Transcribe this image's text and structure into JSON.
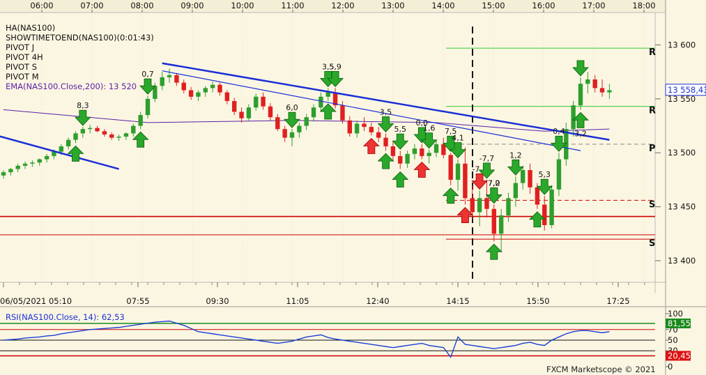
{
  "time_axis_top": [
    "06:00",
    "07:00",
    "08:00",
    "09:00",
    "10:00",
    "11:00",
    "12:00",
    "13:00",
    "14:00",
    "15:00",
    "16:00",
    "17:00",
    "18:00"
  ],
  "date_axis_bottom": [
    "06/05/2021 05:10",
    "07:55",
    "09:30",
    "11:05",
    "12:40",
    "14:15",
    "15:50",
    "17:25"
  ],
  "legend": [
    "HA(NAS100)",
    "SHOWTIMETOEND(NAS100)(0:01:43)",
    "PIVOT J",
    "PIVOT 4H",
    "PIVOT S",
    "PIVOT M"
  ],
  "ema_label": "EMA(NAS100.Close,200): 13 520",
  "rsi_label": "RSI(NAS100.Close, 14): 62,53",
  "copyright": "FXCM Marketscope © 2021",
  "colors": {
    "background": "#fbf6e2",
    "bull_candle": "#2e9e2e",
    "bear_candle": "#e02020",
    "trendline": "#1a2fd6",
    "ema": "#5a1fa8",
    "pivot_red": "#cc0000",
    "pivot_green": "#33cc33",
    "rsi_line": "#1a3fd6"
  },
  "chart_data": {
    "type": "candlestick",
    "price_axis": {
      "ticks": [
        13600,
        13550,
        13500,
        13450,
        13400
      ],
      "tick_labels": [
        "13 600",
        "13 550",
        "13 500",
        "13 450",
        "13 400"
      ],
      "range": [
        13380,
        13630
      ]
    },
    "current_price": {
      "value": 13558.43,
      "label": "13 558,43"
    },
    "pivot_lines": [
      {
        "label": "R",
        "value": 13597,
        "color": "#33cc33",
        "style": "solid"
      },
      {
        "label": "R",
        "value": 13543,
        "color": "#33cc33",
        "style": "solid"
      },
      {
        "label": "P",
        "value": 13508,
        "color": "#888888",
        "style": "dashed"
      },
      {
        "label": "S",
        "value": 13456,
        "color": "#cc0000",
        "style": "dashed"
      },
      {
        "label": "S",
        "value": 13420,
        "color": "#cc0000",
        "style": "solid"
      },
      {
        "label": "",
        "value": 13441,
        "color": "#cc0000",
        "style": "solid"
      },
      {
        "label": "",
        "value": 13424,
        "color": "#cc0000",
        "style": "solid"
      }
    ],
    "ohlc": [
      [
        13479,
        13484,
        13476,
        13482
      ],
      [
        13482,
        13486,
        13479,
        13485
      ],
      [
        13485,
        13490,
        13482,
        13488
      ],
      [
        13488,
        13492,
        13485,
        13490
      ],
      [
        13490,
        13493,
        13487,
        13491
      ],
      [
        13491,
        13495,
        13488,
        13494
      ],
      [
        13494,
        13499,
        13491,
        13497
      ],
      [
        13497,
        13503,
        13494,
        13501
      ],
      [
        13501,
        13508,
        13498,
        13506
      ],
      [
        13506,
        13514,
        13503,
        13512
      ],
      [
        13512,
        13520,
        13509,
        13518
      ],
      [
        13518,
        13524,
        13514,
        13522
      ],
      [
        13522,
        13526,
        13518,
        13523
      ],
      [
        13523,
        13525,
        13519,
        13520
      ],
      [
        13520,
        13522,
        13515,
        13517
      ],
      [
        13517,
        13519,
        13512,
        13514
      ],
      [
        13514,
        13517,
        13511,
        13515
      ],
      [
        13515,
        13519,
        13512,
        13518
      ],
      [
        13518,
        13527,
        13515,
        13525
      ],
      [
        13525,
        13538,
        13522,
        13535
      ],
      [
        13535,
        13553,
        13532,
        13550
      ],
      [
        13550,
        13565,
        13547,
        13562
      ],
      [
        13562,
        13575,
        13558,
        13570
      ],
      [
        13570,
        13578,
        13565,
        13572
      ],
      [
        13572,
        13574,
        13562,
        13565
      ],
      [
        13565,
        13568,
        13555,
        13558
      ],
      [
        13558,
        13561,
        13549,
        13552
      ],
      [
        13552,
        13558,
        13548,
        13556
      ],
      [
        13556,
        13562,
        13552,
        13560
      ],
      [
        13560,
        13566,
        13556,
        13563
      ],
      [
        13563,
        13565,
        13553,
        13556
      ],
      [
        13556,
        13558,
        13545,
        13548
      ],
      [
        13548,
        13551,
        13535,
        13538
      ],
      [
        13538,
        13542,
        13528,
        13532
      ],
      [
        13532,
        13545,
        13530,
        13542
      ],
      [
        13542,
        13555,
        13539,
        13552
      ],
      [
        13552,
        13556,
        13540,
        13543
      ],
      [
        13543,
        13546,
        13530,
        13533
      ],
      [
        13533,
        13536,
        13520,
        13522
      ],
      [
        13522,
        13525,
        13510,
        13514
      ],
      [
        13514,
        13522,
        13506,
        13519
      ],
      [
        13519,
        13528,
        13514,
        13525
      ],
      [
        13525,
        13536,
        13521,
        13533
      ],
      [
        13533,
        13545,
        13529,
        13542
      ],
      [
        13542,
        13556,
        13538,
        13552
      ],
      [
        13552,
        13560,
        13548,
        13556
      ],
      [
        13556,
        13560,
        13541,
        13544
      ],
      [
        13544,
        13548,
        13527,
        13530
      ],
      [
        13530,
        13534,
        13515,
        13518
      ],
      [
        13518,
        13530,
        13514,
        13527
      ],
      [
        13527,
        13533,
        13520,
        13524
      ],
      [
        13524,
        13528,
        13516,
        13519
      ],
      [
        13519,
        13524,
        13510,
        13514
      ],
      [
        13514,
        13518,
        13502,
        13506
      ],
      [
        13506,
        13510,
        13492,
        13497
      ],
      [
        13497,
        13502,
        13485,
        13490
      ],
      [
        13490,
        13502,
        13486,
        13499
      ],
      [
        13499,
        13508,
        13494,
        13504
      ],
      [
        13504,
        13508,
        13494,
        13497
      ],
      [
        13497,
        13503,
        13490,
        13500
      ],
      [
        13500,
        13512,
        13496,
        13508
      ],
      [
        13508,
        13514,
        13495,
        13498
      ],
      [
        13498,
        13500,
        13470,
        13475
      ],
      [
        13475,
        13494,
        13465,
        13490
      ],
      [
        13490,
        13505,
        13452,
        13458
      ],
      [
        13458,
        13470,
        13438,
        13445
      ],
      [
        13445,
        13465,
        13432,
        13458
      ],
      [
        13458,
        13475,
        13440,
        13448
      ],
      [
        13448,
        13452,
        13418,
        13425
      ],
      [
        13425,
        13448,
        13408,
        13442
      ],
      [
        13442,
        13463,
        13436,
        13458
      ],
      [
        13458,
        13478,
        13450,
        13472
      ],
      [
        13472,
        13488,
        13466,
        13484
      ],
      [
        13484,
        13490,
        13462,
        13468
      ],
      [
        13468,
        13472,
        13448,
        13452
      ],
      [
        13452,
        13460,
        13428,
        13433
      ],
      [
        13433,
        13470,
        13430,
        13466
      ],
      [
        13466,
        13500,
        13460,
        13494
      ],
      [
        13494,
        13528,
        13488,
        13522
      ],
      [
        13522,
        13548,
        13515,
        13544
      ],
      [
        13544,
        13570,
        13540,
        13564
      ],
      [
        13564,
        13575,
        13555,
        13568
      ],
      [
        13568,
        13572,
        13556,
        13560
      ],
      [
        13560,
        13568,
        13552,
        13556
      ],
      [
        13556,
        13564,
        13550,
        13558
      ]
    ],
    "ema": [
      [
        0,
        13540
      ],
      [
        20,
        13528
      ],
      [
        40,
        13530
      ],
      [
        60,
        13528
      ],
      [
        75,
        13520
      ],
      [
        84,
        13522
      ]
    ],
    "trendlines": [
      {
        "from": [
          22,
          13583
        ],
        "to": [
          84,
          13512
        ],
        "width": 2.5
      },
      {
        "from": [
          22,
          13576
        ],
        "to": [
          80,
          13502
        ],
        "width": 1.2
      },
      {
        "from": [
          -2,
          13518
        ],
        "to": [
          16,
          13485
        ],
        "width": 2.5
      }
    ],
    "arrows": [
      {
        "i": 11,
        "dir": "down",
        "label": "8,3",
        "color": "green"
      },
      {
        "i": 10,
        "dir": "up",
        "label": "",
        "color": "green"
      },
      {
        "i": 20,
        "dir": "down",
        "label": "0,7",
        "color": "green"
      },
      {
        "i": 19,
        "dir": "up",
        "label": "",
        "color": "green"
      },
      {
        "i": 40,
        "dir": "down",
        "label": "6,0",
        "color": "green"
      },
      {
        "i": 45,
        "dir": "down",
        "label": "3,5",
        "color": "green"
      },
      {
        "i": 46,
        "dir": "down",
        "label": "5,9",
        "color": "green"
      },
      {
        "i": 45,
        "dir": "up",
        "label": "",
        "color": "green"
      },
      {
        "i": 51,
        "dir": "up",
        "label": "",
        "color": "red"
      },
      {
        "i": 53,
        "dir": "down",
        "label": "3,5",
        "color": "green"
      },
      {
        "i": 55,
        "dir": "down",
        "label": "5,5",
        "color": "green"
      },
      {
        "i": 53,
        "dir": "up",
        "label": "",
        "color": "green"
      },
      {
        "i": 55,
        "dir": "up",
        "label": "",
        "color": "green"
      },
      {
        "i": 58,
        "dir": "down",
        "label": "0,0",
        "color": "green"
      },
      {
        "i": 59,
        "dir": "down",
        "label": "1,6",
        "color": "green"
      },
      {
        "i": 58,
        "dir": "up",
        "label": "",
        "color": "red"
      },
      {
        "i": 62,
        "dir": "down",
        "label": "7,5",
        "color": "green"
      },
      {
        "i": 63,
        "dir": "down",
        "label": "4,1",
        "color": "green"
      },
      {
        "i": 62,
        "dir": "up",
        "label": "",
        "color": "green"
      },
      {
        "i": 64,
        "dir": "up",
        "label": "",
        "color": "red"
      },
      {
        "i": 66,
        "dir": "down",
        "label": "-7,2",
        "color": "red"
      },
      {
        "i": 67,
        "dir": "down",
        "label": "-7,7",
        "color": "green"
      },
      {
        "i": 68,
        "dir": "down",
        "label": "7,2",
        "color": "green"
      },
      {
        "i": 68,
        "dir": "up",
        "label": "",
        "color": "green"
      },
      {
        "i": 71,
        "dir": "down",
        "label": "1,2",
        "color": "green"
      },
      {
        "i": 68,
        "dir": "down",
        "label": "7,0",
        "color": "green"
      },
      {
        "i": 75,
        "dir": "down",
        "label": "5,3",
        "color": "green"
      },
      {
        "i": 74,
        "dir": "up",
        "label": "",
        "color": "green"
      },
      {
        "i": 77,
        "dir": "down",
        "label": "0,4",
        "color": "green"
      },
      {
        "i": 80,
        "dir": "down",
        "label": "",
        "color": "green"
      },
      {
        "i": 80,
        "dir": "up",
        "label": "3,2",
        "color": "green"
      }
    ],
    "rsi": {
      "axis_ticks": [
        100,
        70,
        50,
        30,
        0
      ],
      "levels": [
        {
          "label": "81,55",
          "value": 81.55,
          "color": "#1a8a1a"
        },
        {
          "label": "20,45",
          "value": 20.45,
          "color": "#dd1111"
        }
      ],
      "values": [
        50,
        51,
        52,
        54,
        55,
        56,
        58,
        59,
        62,
        64,
        66,
        68,
        70,
        71,
        72,
        73,
        74,
        76,
        78,
        80,
        82,
        84,
        85,
        86,
        82,
        78,
        72,
        66,
        64,
        62,
        60,
        58,
        56,
        54,
        52,
        50,
        48,
        46,
        44,
        46,
        48,
        52,
        56,
        58,
        60,
        55,
        52,
        50,
        48,
        46,
        44,
        42,
        40,
        38,
        36,
        38,
        40,
        42,
        44,
        40,
        38,
        36,
        18,
        56,
        42,
        40,
        38,
        36,
        34,
        36,
        38,
        40,
        44,
        46,
        42,
        40,
        50,
        56,
        62,
        66,
        68,
        68,
        66,
        64,
        66
      ]
    }
  }
}
